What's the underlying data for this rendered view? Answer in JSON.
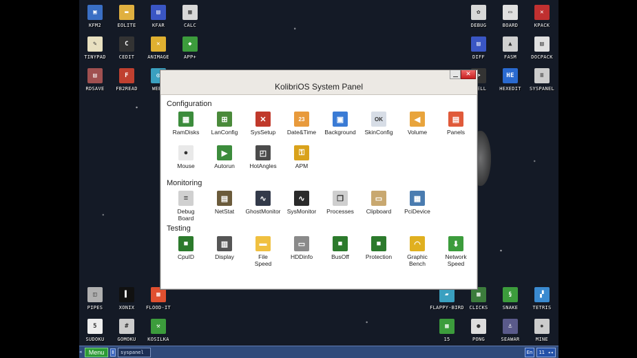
{
  "window": {
    "title": "KolibriOS System Panel",
    "sections": [
      {
        "title": "Configuration",
        "items": [
          {
            "label": "RamDisks",
            "icon": "ramdisk-icon",
            "color": "#3c8c3c",
            "glyph": "▦"
          },
          {
            "label": "LanConfig",
            "icon": "network-card-icon",
            "color": "#4a8a3a",
            "glyph": "⊞"
          },
          {
            "label": "SysSetup",
            "icon": "tools-icon",
            "color": "#c0392b",
            "glyph": "✕"
          },
          {
            "label": "Date&Time",
            "icon": "calendar-icon",
            "color": "#e89a3c",
            "glyph": "23"
          },
          {
            "label": "Background",
            "icon": "monitor-colors-icon",
            "color": "#3a7bd5",
            "glyph": "▣"
          },
          {
            "label": "SkinConfig",
            "icon": "window-skin-icon",
            "color": "#d7dde6",
            "glyph": "OK"
          },
          {
            "label": "Volume",
            "icon": "speaker-icon",
            "color": "#e8a43c",
            "glyph": "◀"
          },
          {
            "label": "Panels",
            "icon": "panels-icon",
            "color": "#e05a3a",
            "glyph": "▤"
          },
          {
            "label": "Mouse",
            "icon": "mouse-icon",
            "color": "#e9e9e9",
            "glyph": "●"
          },
          {
            "label": "Autorun",
            "icon": "autorun-icon",
            "color": "#3c8c3c",
            "glyph": "▶"
          },
          {
            "label": "HotAngles",
            "icon": "hot-angles-icon",
            "color": "#4b4b4b",
            "glyph": "◰"
          },
          {
            "label": "APM",
            "icon": "apm-icon",
            "color": "#d9a21b",
            "glyph": "⚿"
          }
        ]
      },
      {
        "title": "Monitoring",
        "items": [
          {
            "label": "Debug\nBoard",
            "icon": "debug-board-icon",
            "color": "#d0d0d0",
            "glyph": "≡"
          },
          {
            "label": "NetStat",
            "icon": "netstat-icon",
            "color": "#6b5b3b",
            "glyph": "▤"
          },
          {
            "label": "GhostMonitor",
            "icon": "ghost-monitor-icon",
            "color": "#333a4a",
            "glyph": "∿"
          },
          {
            "label": "SysMonitor",
            "icon": "sysmonitor-icon",
            "color": "#2a2a2a",
            "glyph": "∿"
          },
          {
            "label": "Processes",
            "icon": "processes-icon",
            "color": "#cfcfcf",
            "glyph": "❐"
          },
          {
            "label": "Clipboard",
            "icon": "clipboard-icon",
            "color": "#c8a870",
            "glyph": "▭"
          },
          {
            "label": "PciDevice",
            "icon": "pci-device-icon",
            "color": "#4a7cb0",
            "glyph": "▦"
          }
        ]
      },
      {
        "title": "Testing",
        "items": [
          {
            "label": "CpuID",
            "icon": "cpu-icon",
            "color": "#2c7a2c",
            "glyph": "■"
          },
          {
            "label": "Display",
            "icon": "display-icon",
            "color": "#555",
            "glyph": "▥"
          },
          {
            "label": "File\nSpeed",
            "icon": "folder-icon",
            "color": "#f0c040",
            "glyph": "▬"
          },
          {
            "label": "HDDinfo",
            "icon": "hdd-icon",
            "color": "#8a8a8a",
            "glyph": "▭"
          },
          {
            "label": "BusOff",
            "icon": "bus-chip-icon",
            "color": "#2c7a2c",
            "glyph": "■"
          },
          {
            "label": "Protection",
            "icon": "protection-chip-icon",
            "color": "#2c7a2c",
            "glyph": "■"
          },
          {
            "label": "Graphic\nBench",
            "icon": "gauge-icon",
            "color": "#e0b020",
            "glyph": "◠"
          },
          {
            "label": "Network\nSpeed",
            "icon": "download-icon",
            "color": "#3c9c3c",
            "glyph": "⬇"
          }
        ]
      }
    ]
  },
  "desktop": {
    "left_icons": [
      {
        "label": "KFM2",
        "icon": "floppy-icon",
        "color": "#3a6fc4",
        "glyph": "▣"
      },
      {
        "label": "EOLITE",
        "icon": "folder-icon",
        "color": "#e0b040",
        "glyph": "▬"
      },
      {
        "label": "KFAR",
        "icon": "kfar-icon",
        "color": "#3a56c4",
        "glyph": "▤"
      },
      {
        "label": "CALC",
        "icon": "calculator-icon",
        "color": "#d8d8d8",
        "glyph": "▦"
      },
      {
        "label": "TINYPAD",
        "icon": "notepad-icon",
        "color": "#e8e0c0",
        "glyph": "✎"
      },
      {
        "label": "CEDIT",
        "icon": "code-editor-icon",
        "color": "#333",
        "glyph": "C"
      },
      {
        "label": "ANIMAGE",
        "icon": "animage-icon",
        "color": "#e0b030",
        "glyph": "✕"
      },
      {
        "label": "APP+",
        "icon": "app-plus-icon",
        "color": "#3c9c3c",
        "glyph": "◆"
      },
      {
        "label": "RDSAVE",
        "icon": "rdsave-icon",
        "color": "#a05050",
        "glyph": "▤"
      },
      {
        "label": "FB2READ",
        "icon": "fb2-icon",
        "color": "#c04030",
        "glyph": "F"
      },
      {
        "label": "WEBV",
        "icon": "web-icon",
        "color": "#3aa0c0",
        "glyph": "◎"
      }
    ],
    "right_icons": [
      {
        "label": "DEBUG",
        "icon": "debug-icon",
        "color": "#d8d8d8",
        "glyph": "✿"
      },
      {
        "label": "BOARD",
        "icon": "board-icon",
        "color": "#e0e0e0",
        "glyph": "▭"
      },
      {
        "label": "KPACK",
        "icon": "kpack-icon",
        "color": "#c03030",
        "glyph": "✕"
      },
      {
        "label": "DIFF",
        "icon": "diff-icon",
        "color": "#3a56c4",
        "glyph": "▤"
      },
      {
        "label": "FASM",
        "icon": "fasm-icon",
        "color": "#d0d0d0",
        "glyph": "▲"
      },
      {
        "label": "DOCPACK",
        "icon": "docpack-icon",
        "color": "#e0e0e0",
        "glyph": "▤"
      },
      {
        "label": "SHELL",
        "icon": "shell-icon",
        "color": "#333",
        "glyph": ">"
      },
      {
        "label": "HEXEDIT",
        "icon": "hexedit-icon",
        "color": "#2a6ad0",
        "glyph": "HE"
      },
      {
        "label": "SYSPANEL",
        "icon": "syspanel-icon",
        "color": "#ccc",
        "glyph": "≡"
      }
    ],
    "bottom_left_icons": [
      {
        "label": "PIPES",
        "icon": "pipes-icon",
        "color": "#b0b0b0",
        "glyph": "◫"
      },
      {
        "label": "XONIX",
        "icon": "xonix-icon",
        "color": "#111",
        "glyph": "▌"
      },
      {
        "label": "FLOOD-IT",
        "icon": "flood-it-icon",
        "color": "#e05030",
        "glyph": "▦"
      },
      {
        "label": "SUDOKU",
        "icon": "sudoku-icon",
        "color": "#eee",
        "glyph": "5"
      },
      {
        "label": "GOMOKU",
        "icon": "gomoku-icon",
        "color": "#ccc",
        "glyph": "#"
      },
      {
        "label": "KOSILKA",
        "icon": "kosilka-icon",
        "color": "#3c9c3c",
        "glyph": "⚒"
      }
    ],
    "bottom_right_icons": [
      {
        "label": "FLAPPY-BIRD",
        "icon": "flappy-bird-icon",
        "color": "#3aa0c0",
        "glyph": "▰"
      },
      {
        "label": "CLICKS",
        "icon": "clicks-icon",
        "color": "#3c7c3c",
        "glyph": "▦"
      },
      {
        "label": "SNAKE",
        "icon": "snake-icon",
        "color": "#3c9c3c",
        "glyph": "§"
      },
      {
        "label": "TETRIS",
        "icon": "tetris-icon",
        "color": "#3a8ad0",
        "glyph": "▞"
      },
      {
        "label": "15",
        "icon": "fifteen-icon",
        "color": "#3c9c3c",
        "glyph": "▦"
      },
      {
        "label": "PONG",
        "icon": "pong-icon",
        "color": "#ddd",
        "glyph": "●"
      },
      {
        "label": "SEAWAR",
        "icon": "seawar-icon",
        "color": "#5a5a8a",
        "glyph": "⚓"
      },
      {
        "label": "MINE",
        "icon": "mine-icon",
        "color": "#ccc",
        "glyph": "✹"
      }
    ]
  },
  "taskbar": {
    "menu_label": "Menu",
    "switch_glyph": "⇕",
    "arrow_glyph": "◂",
    "task_label": "syspanel",
    "lang_label": "En",
    "clock_label": "11 ◂◂"
  }
}
